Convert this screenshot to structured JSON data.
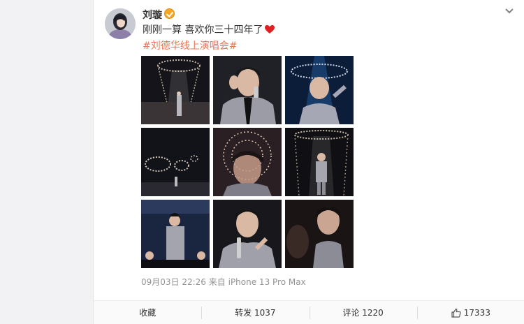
{
  "post": {
    "username": "刘璇",
    "text": "刚刚一算 喜欢你三十四年了",
    "hashtag": "#刘德华线上演唱会#",
    "timestamp": "09月03日 22:26",
    "source_prefix": "来自",
    "source": "iPhone 13 Pro Max"
  },
  "actions": {
    "favorite_label": "收藏",
    "repost_label": "转发 1037",
    "comment_label": "评论 1220",
    "like_count": "17333"
  },
  "icons": {
    "verified": "verified-badge-icon",
    "menu": "chevron-down-icon",
    "heart": "heart-icon",
    "like": "thumbs-up-icon"
  },
  "colors": {
    "hashtag": "#eb7350",
    "meta": "#939393",
    "heart": "#e02020",
    "verified": "#f5a623"
  }
}
